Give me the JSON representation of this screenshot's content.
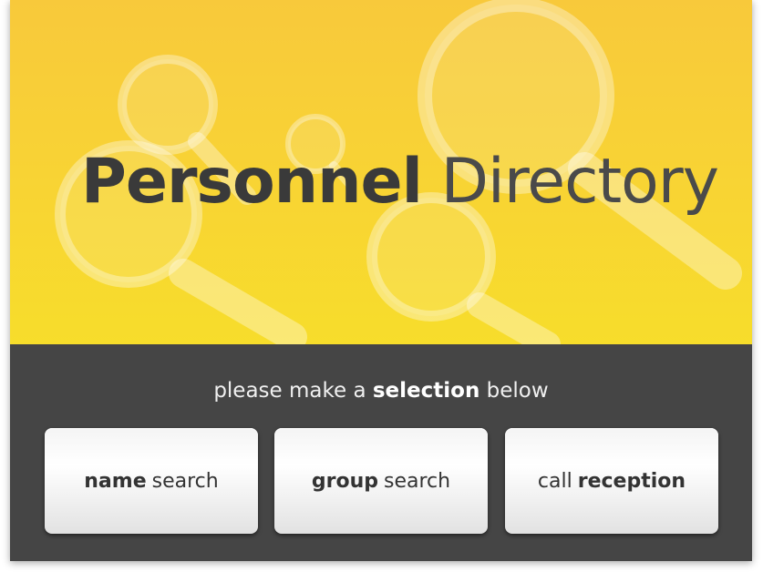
{
  "header": {
    "title_bold": "Personnel",
    "title_light": "Directory"
  },
  "panel": {
    "prompt_before": "please make a",
    "prompt_bold": "selection",
    "prompt_after": "below"
  },
  "buttons": {
    "name_search": {
      "bold": "name",
      "normal": "search"
    },
    "group_search": {
      "bold": "group",
      "normal": "search"
    },
    "call_reception": {
      "normal": "call",
      "bold": "reception"
    }
  },
  "colors": {
    "banner_yellow": "#f8d235",
    "panel_gray": "#454545",
    "title_text": "#3a3a3a"
  },
  "icons": [
    "magnifying-glass-icon"
  ]
}
